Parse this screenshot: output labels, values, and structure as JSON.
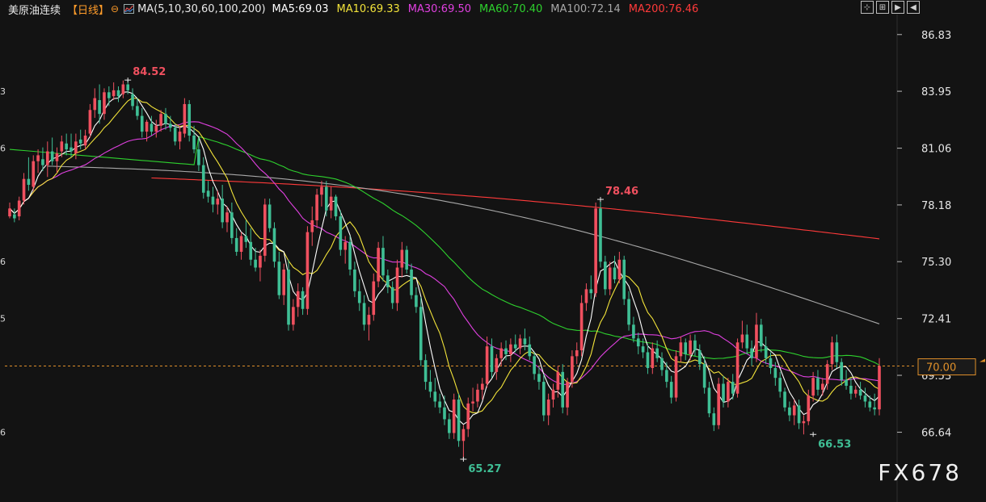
{
  "header": {
    "symbol": "美原油连续",
    "period": "【日线】",
    "ma_definition": "MA(5,10,30,60,100,200)",
    "ma_values": [
      {
        "label": "MA5:69.03",
        "color": "#ffffff"
      },
      {
        "label": "MA10:69.33",
        "color": "#f2e33a"
      },
      {
        "label": "MA30:69.50",
        "color": "#e040e0"
      },
      {
        "label": "MA60:70.40",
        "color": "#2ed12e"
      },
      {
        "label": "MA100:72.14",
        "color": "#a8a8a8"
      },
      {
        "label": "MA200:76.46",
        "color": "#ff3a3a"
      }
    ]
  },
  "watermark": "FX678",
  "chart_data": {
    "type": "candlestick",
    "y_ticks": [
      "86.83",
      "83.95",
      "81.06",
      "78.18",
      "75.30",
      "72.41",
      "69.53",
      "66.64"
    ],
    "y_tick_values": [
      86.83,
      83.95,
      81.06,
      78.18,
      75.3,
      72.41,
      69.53,
      66.64
    ],
    "left_tick_partials": [
      "3",
      "6",
      "6",
      "5",
      "6"
    ],
    "ylim": [
      64.0,
      87.6
    ],
    "current_price": 70.0,
    "current_price_label": "70.00",
    "annotations": [
      {
        "label": "84.52",
        "value": 84.52,
        "index": 25,
        "kind": "high"
      },
      {
        "label": "78.46",
        "value": 78.46,
        "index": 125,
        "kind": "high"
      },
      {
        "label": "65.27",
        "value": 65.27,
        "index": 96,
        "kind": "low"
      },
      {
        "label": "66.53",
        "value": 66.53,
        "index": 170,
        "kind": "low"
      }
    ],
    "up_color": "#f0505f",
    "down_color": "#3fbf95",
    "candles": [
      [
        77.6,
        78.3,
        77.5,
        78.0
      ],
      [
        77.7,
        78.0,
        77.3,
        77.5
      ],
      [
        77.6,
        78.6,
        77.4,
        78.4
      ],
      [
        78.4,
        79.8,
        78.2,
        79.5
      ],
      [
        79.5,
        80.6,
        78.9,
        79.2
      ],
      [
        79.1,
        80.7,
        78.9,
        80.4
      ],
      [
        80.4,
        81.0,
        79.8,
        80.7
      ],
      [
        80.5,
        81.1,
        79.9,
        80.2
      ],
      [
        80.2,
        81.4,
        79.6,
        80.9
      ],
      [
        80.9,
        81.6,
        80.2,
        80.4
      ],
      [
        80.4,
        81.1,
        79.8,
        80.8
      ],
      [
        80.9,
        81.7,
        80.6,
        81.4
      ],
      [
        81.3,
        81.8,
        80.7,
        81.0
      ],
      [
        81.1,
        81.8,
        80.6,
        80.9
      ],
      [
        80.8,
        81.8,
        80.5,
        81.4
      ],
      [
        81.5,
        82.0,
        81.0,
        81.3
      ],
      [
        81.2,
        82.0,
        81.0,
        81.7
      ],
      [
        81.8,
        83.3,
        81.6,
        83.0
      ],
      [
        83.0,
        84.1,
        82.6,
        83.6
      ],
      [
        83.5,
        84.3,
        82.3,
        82.8
      ],
      [
        82.8,
        84.1,
        82.5,
        83.9
      ],
      [
        83.9,
        84.2,
        83.2,
        83.6
      ],
      [
        83.7,
        84.4,
        83.5,
        84.0
      ],
      [
        84.0,
        84.2,
        83.4,
        83.7
      ],
      [
        83.8,
        84.5,
        83.6,
        84.3
      ],
      [
        84.3,
        84.52,
        83.8,
        84.0
      ],
      [
        83.8,
        84.1,
        83.0,
        83.2
      ],
      [
        83.2,
        83.6,
        82.5,
        82.7
      ],
      [
        82.7,
        83.1,
        81.6,
        81.9
      ],
      [
        81.9,
        82.5,
        81.4,
        82.4
      ],
      [
        82.3,
        82.7,
        81.7,
        81.9
      ],
      [
        81.9,
        82.5,
        81.6,
        82.2
      ],
      [
        82.2,
        83.0,
        81.9,
        82.8
      ],
      [
        82.8,
        83.1,
        82.0,
        82.3
      ],
      [
        82.3,
        82.7,
        81.9,
        82.1
      ],
      [
        82.1,
        82.3,
        81.2,
        81.4
      ],
      [
        81.4,
        82.2,
        81.0,
        81.9
      ],
      [
        81.8,
        83.6,
        81.6,
        83.3
      ],
      [
        83.3,
        83.5,
        81.4,
        81.7
      ],
      [
        81.7,
        82.2,
        80.8,
        81.0
      ],
      [
        81.0,
        81.6,
        79.9,
        80.2
      ],
      [
        80.2,
        80.6,
        78.5,
        78.8
      ],
      [
        78.9,
        79.4,
        78.3,
        78.6
      ],
      [
        78.6,
        79.1,
        77.8,
        78.2
      ],
      [
        78.2,
        78.9,
        77.7,
        78.5
      ],
      [
        78.5,
        79.2,
        77.0,
        77.3
      ],
      [
        77.3,
        78.1,
        76.8,
        77.8
      ],
      [
        77.8,
        78.3,
        76.2,
        76.5
      ],
      [
        76.5,
        77.0,
        75.6,
        75.8
      ],
      [
        75.8,
        76.8,
        75.4,
        76.6
      ],
      [
        76.6,
        77.4,
        76.0,
        76.3
      ],
      [
        76.3,
        77.0,
        75.1,
        75.4
      ],
      [
        75.4,
        76.0,
        74.8,
        75.0
      ],
      [
        75.0,
        75.9,
        74.3,
        75.6
      ],
      [
        75.6,
        78.5,
        75.3,
        78.2
      ],
      [
        78.2,
        78.5,
        76.8,
        77.0
      ],
      [
        77.0,
        77.3,
        75.0,
        75.3
      ],
      [
        75.3,
        75.8,
        73.4,
        73.6
      ],
      [
        73.6,
        75.2,
        73.1,
        74.9
      ],
      [
        74.9,
        75.4,
        71.8,
        72.1
      ],
      [
        72.1,
        73.4,
        71.8,
        73.0
      ],
      [
        73.0,
        74.2,
        72.5,
        73.8
      ],
      [
        73.8,
        74.0,
        72.6,
        72.9
      ],
      [
        72.9,
        77.1,
        72.6,
        76.8
      ],
      [
        76.8,
        78.1,
        76.1,
        77.4
      ],
      [
        77.4,
        79.0,
        77.0,
        78.7
      ],
      [
        78.7,
        79.4,
        78.1,
        79.1
      ],
      [
        79.1,
        79.4,
        77.6,
        77.9
      ],
      [
        77.9,
        79.1,
        77.5,
        78.6
      ],
      [
        78.6,
        78.7,
        77.4,
        77.6
      ],
      [
        77.6,
        77.9,
        75.6,
        75.9
      ],
      [
        75.9,
        76.6,
        75.2,
        76.3
      ],
      [
        76.3,
        76.6,
        74.6,
        74.9
      ],
      [
        74.9,
        75.3,
        73.5,
        73.8
      ],
      [
        73.8,
        74.4,
        72.8,
        73.2
      ],
      [
        73.2,
        73.6,
        71.8,
        72.1
      ],
      [
        72.1,
        73.0,
        71.3,
        72.6
      ],
      [
        72.6,
        74.7,
        72.3,
        74.3
      ],
      [
        74.3,
        76.3,
        74.0,
        76.0
      ],
      [
        76.0,
        76.6,
        74.3,
        74.6
      ],
      [
        74.6,
        74.9,
        73.7,
        74.0
      ],
      [
        74.0,
        74.3,
        72.9,
        73.2
      ],
      [
        73.2,
        75.4,
        72.8,
        75.0
      ],
      [
        75.0,
        76.3,
        74.5,
        75.9
      ],
      [
        75.9,
        76.1,
        74.7,
        74.9
      ],
      [
        74.9,
        75.2,
        73.4,
        73.6
      ],
      [
        73.6,
        74.0,
        72.7,
        73.0
      ],
      [
        73.0,
        73.5,
        70.0,
        70.3
      ],
      [
        70.3,
        70.6,
        68.8,
        69.2
      ],
      [
        69.2,
        69.8,
        68.4,
        68.7
      ],
      [
        68.7,
        69.4,
        67.9,
        68.2
      ],
      [
        68.2,
        68.6,
        67.6,
        67.9
      ],
      [
        67.9,
        68.5,
        67.0,
        67.3
      ],
      [
        67.3,
        67.6,
        66.3,
        66.6
      ],
      [
        66.6,
        68.6,
        66.3,
        68.3
      ],
      [
        68.3,
        68.6,
        65.9,
        66.2
      ],
      [
        66.2,
        67.0,
        65.27,
        66.8
      ],
      [
        66.8,
        68.4,
        66.4,
        68.1
      ],
      [
        68.1,
        68.9,
        67.7,
        68.2
      ],
      [
        68.2,
        69.1,
        67.9,
        68.8
      ],
      [
        68.8,
        69.4,
        68.3,
        69.1
      ],
      [
        69.1,
        71.5,
        68.9,
        71.0
      ],
      [
        71.0,
        71.4,
        69.4,
        69.7
      ],
      [
        69.7,
        70.6,
        69.3,
        70.4
      ],
      [
        70.4,
        71.2,
        70.0,
        70.9
      ],
      [
        70.9,
        71.3,
        70.3,
        70.6
      ],
      [
        70.6,
        71.4,
        70.2,
        71.1
      ],
      [
        71.1,
        71.6,
        70.7,
        70.9
      ],
      [
        70.9,
        71.6,
        70.6,
        71.4
      ],
      [
        71.4,
        71.9,
        70.8,
        71.1
      ],
      [
        71.1,
        71.5,
        70.3,
        70.5
      ],
      [
        70.5,
        70.7,
        69.3,
        69.6
      ],
      [
        69.6,
        70.0,
        68.8,
        69.2
      ],
      [
        69.2,
        69.6,
        67.2,
        67.5
      ],
      [
        67.5,
        68.6,
        67.0,
        68.3
      ],
      [
        68.3,
        69.1,
        67.9,
        68.8
      ],
      [
        68.8,
        70.0,
        68.4,
        69.7
      ],
      [
        69.7,
        70.1,
        67.6,
        67.9
      ],
      [
        67.9,
        69.4,
        67.5,
        69.2
      ],
      [
        69.2,
        70.8,
        68.9,
        70.5
      ],
      [
        70.5,
        71.2,
        70.1,
        70.8
      ],
      [
        70.8,
        73.6,
        70.5,
        73.2
      ],
      [
        73.2,
        74.2,
        72.8,
        73.9
      ],
      [
        73.9,
        74.6,
        73.4,
        73.7
      ],
      [
        73.7,
        78.3,
        73.5,
        78.0
      ],
      [
        78.0,
        78.46,
        75.0,
        75.3
      ],
      [
        75.3,
        75.6,
        73.6,
        73.9
      ],
      [
        73.9,
        75.3,
        73.6,
        75.0
      ],
      [
        75.0,
        75.6,
        74.2,
        74.4
      ],
      [
        74.4,
        75.8,
        74.2,
        75.4
      ],
      [
        75.4,
        75.6,
        73.1,
        73.4
      ],
      [
        73.4,
        73.8,
        71.8,
        72.1
      ],
      [
        72.1,
        72.5,
        71.2,
        71.4
      ],
      [
        71.4,
        71.7,
        70.6,
        71.0
      ],
      [
        71.0,
        71.4,
        70.4,
        70.7
      ],
      [
        70.7,
        71.1,
        69.6,
        69.9
      ],
      [
        69.9,
        71.2,
        69.6,
        70.9
      ],
      [
        70.9,
        71.3,
        70.2,
        70.4
      ],
      [
        70.4,
        70.7,
        69.5,
        69.8
      ],
      [
        69.8,
        70.2,
        68.9,
        69.2
      ],
      [
        69.2,
        69.5,
        68.1,
        68.4
      ],
      [
        68.4,
        70.8,
        68.2,
        70.5
      ],
      [
        70.5,
        71.5,
        70.2,
        71.2
      ],
      [
        71.2,
        71.4,
        70.3,
        70.6
      ],
      [
        70.6,
        71.6,
        70.3,
        71.3
      ],
      [
        71.3,
        71.6,
        70.5,
        70.8
      ],
      [
        70.8,
        71.1,
        69.8,
        70.1
      ],
      [
        70.1,
        70.5,
        68.6,
        68.9
      ],
      [
        68.9,
        69.2,
        67.4,
        67.6
      ],
      [
        67.6,
        67.9,
        66.7,
        67.0
      ],
      [
        67.0,
        69.4,
        66.8,
        69.1
      ],
      [
        69.1,
        69.5,
        67.9,
        68.2
      ],
      [
        68.2,
        69.4,
        67.9,
        69.2
      ],
      [
        69.2,
        69.6,
        68.3,
        68.6
      ],
      [
        68.6,
        71.4,
        68.4,
        71.2
      ],
      [
        71.2,
        72.3,
        70.9,
        71.6
      ],
      [
        71.6,
        72.1,
        70.6,
        70.9
      ],
      [
        70.9,
        71.3,
        70.0,
        70.4
      ],
      [
        70.4,
        72.7,
        70.2,
        72.1
      ],
      [
        72.1,
        72.4,
        70.7,
        71.0
      ],
      [
        71.0,
        71.5,
        70.1,
        70.4
      ],
      [
        70.4,
        70.7,
        69.6,
        69.9
      ],
      [
        69.9,
        70.2,
        69.0,
        69.4
      ],
      [
        69.4,
        69.7,
        68.4,
        68.7
      ],
      [
        68.7,
        68.9,
        67.7,
        67.9
      ],
      [
        67.9,
        68.2,
        67.2,
        67.5
      ],
      [
        67.5,
        68.3,
        67.0,
        68.0
      ],
      [
        68.0,
        68.3,
        66.8,
        67.1
      ],
      [
        67.1,
        67.5,
        66.53,
        67.2
      ],
      [
        67.2,
        68.8,
        67.0,
        68.5
      ],
      [
        68.5,
        69.7,
        68.2,
        69.4
      ],
      [
        69.4,
        69.8,
        68.5,
        68.8
      ],
      [
        68.8,
        69.4,
        68.5,
        69.1
      ],
      [
        69.1,
        70.3,
        68.8,
        70.1
      ],
      [
        70.1,
        71.5,
        69.8,
        71.2
      ],
      [
        71.2,
        71.6,
        69.9,
        70.2
      ],
      [
        70.2,
        70.4,
        69.0,
        69.3
      ],
      [
        69.3,
        69.8,
        68.8,
        69.0
      ],
      [
        69.0,
        69.4,
        68.3,
        68.6
      ],
      [
        68.6,
        69.0,
        68.4,
        68.8
      ],
      [
        68.8,
        69.2,
        68.3,
        68.5
      ],
      [
        68.5,
        68.9,
        67.9,
        68.2
      ],
      [
        68.2,
        68.5,
        67.7,
        67.9
      ],
      [
        67.9,
        68.6,
        67.5,
        67.8
      ],
      [
        67.8,
        70.4,
        67.5,
        70.0
      ]
    ]
  }
}
